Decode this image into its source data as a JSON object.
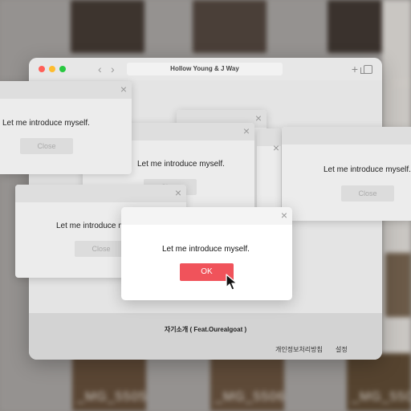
{
  "background": {
    "captions": [
      "_MG_5505",
      "_MG_5506",
      "_MG_5507",
      "_MG_54"
    ]
  },
  "browser": {
    "title": "Hollow Young & J Way",
    "traffic_lights": [
      "#ff5f57",
      "#febc2e",
      "#28c840"
    ],
    "icons": {
      "back": "chevron-left-icon",
      "forward": "chevron-right-icon",
      "new_tab": "plus-icon",
      "tabs": "tabs-icon"
    }
  },
  "footer": {
    "song": "자기소개 ( Feat.Ourealgoat )",
    "links": [
      "개인정보처리방침",
      "설정"
    ]
  },
  "dialog": {
    "message": "Let me introduce myself.",
    "close_label": "Close",
    "ok_label": "OK",
    "close_glyph": "×",
    "accent": "#f0535b"
  }
}
